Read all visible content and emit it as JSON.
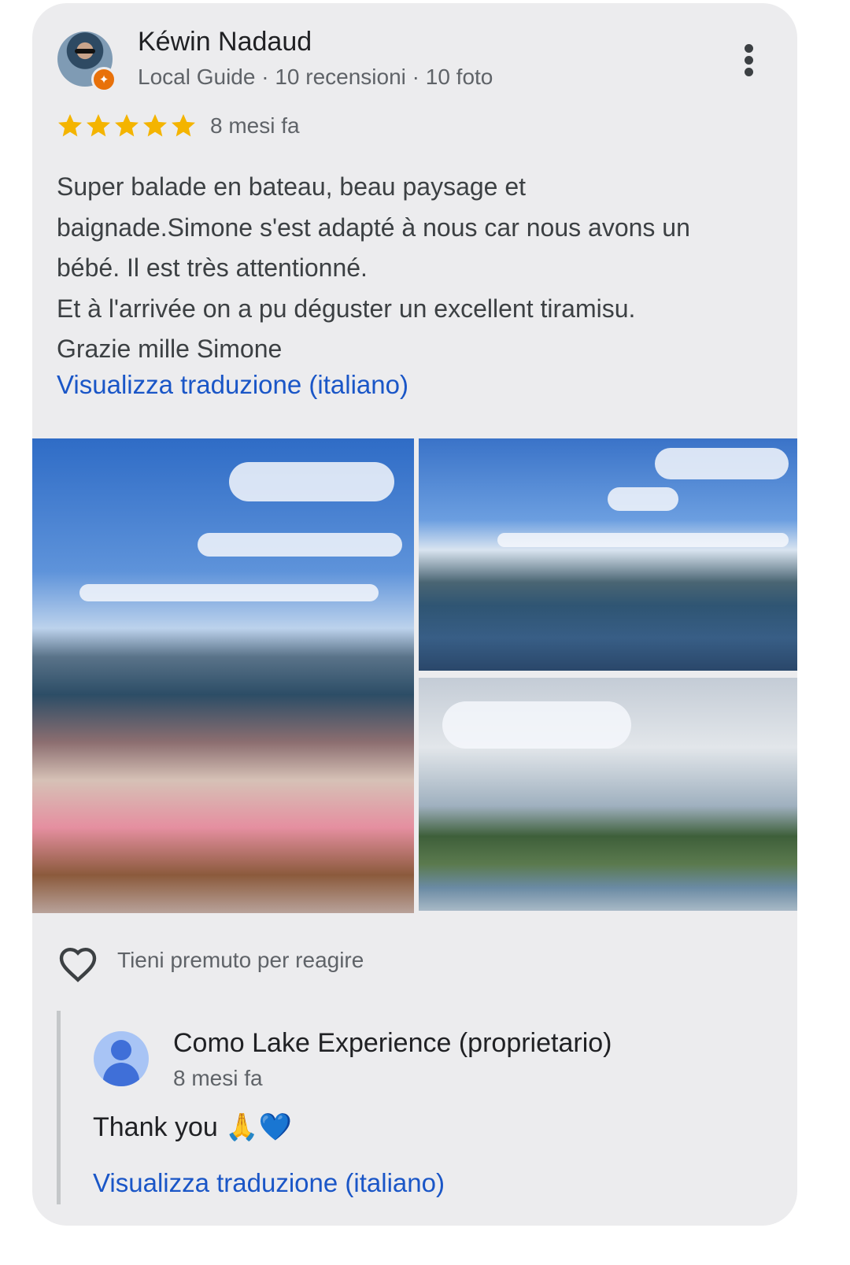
{
  "review": {
    "author": "Kéwin Nadaud",
    "meta": "Local Guide · 10 recensioni · 10 foto",
    "rating": 5,
    "time": "8 mesi fa",
    "body": "Super balade en bateau, beau paysage et\nbaignade.Simone s'est adapté à nous car nous avons un\nbébé. Il est très attentionné.\nEt à l'arrivée on a pu déguster un excellent tiramisu.\nGrazie mille Simone",
    "translate_link": "Visualizza traduzione (italiano)",
    "badge_icon": "local-guide-star-icon",
    "menu_icon": "more-vert-icon",
    "star_color": "#f4b400",
    "link_color": "#1a56c7"
  },
  "reactions": {
    "icon": "heart-outline-icon",
    "label": "Tieni premuto per reagire"
  },
  "owner_reply": {
    "name": "Como Lake Experience (proprietario)",
    "time": "8 mesi fa",
    "text": "Thank you 🙏💙",
    "translate_link": "Visualizza traduzione (italiano)"
  }
}
